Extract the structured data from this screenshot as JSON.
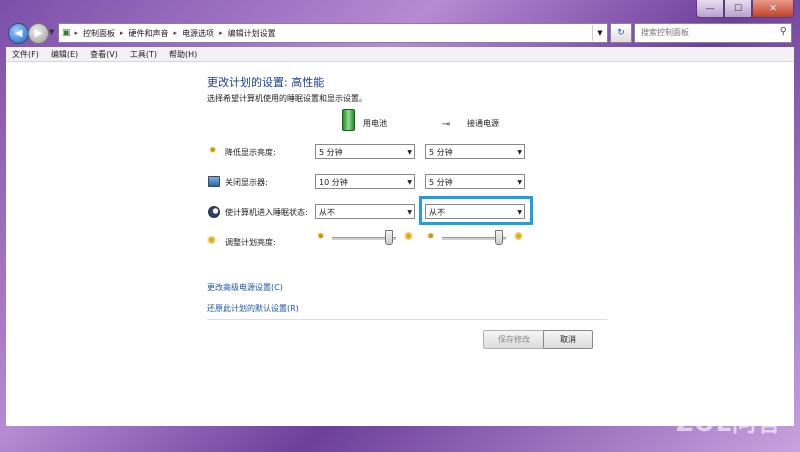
{
  "window": {
    "minimize_glyph": "—",
    "maximize_glyph": "☐",
    "close_glyph": "✕"
  },
  "nav": {
    "back_glyph": "◀",
    "forward_glyph": "▶",
    "breadcrumbs": [
      "控制面板",
      "硬件和声音",
      "电源选项",
      "编辑计划设置"
    ],
    "refresh_glyph": "↻",
    "search_placeholder": "搜索控制面板"
  },
  "menu": [
    "文件(F)",
    "编辑(E)",
    "查看(V)",
    "工具(T)",
    "帮助(H)"
  ],
  "page": {
    "title": "更改计划的设置: 高性能",
    "subtitle": "选择希望计算机使用的睡眠设置和显示设置。",
    "col_battery": "用电池",
    "col_plugged": "接通电源",
    "rows": [
      {
        "label": "降低显示亮度:",
        "battery": "5 分钟",
        "plugged": "5 分钟"
      },
      {
        "label": "关闭显示器:",
        "battery": "10 分钟",
        "plugged": "5 分钟"
      },
      {
        "label": "使计算机进入睡眠状态:",
        "battery": "从不",
        "plugged": "从不"
      }
    ],
    "brightness_label": "调整计划亮度:",
    "brightness_battery_level": 0.88,
    "brightness_plugged_level": 0.88,
    "link_advanced": "更改高级电源设置(C)",
    "link_restore": "还原此计划的默认设置(R)",
    "save_button": "保存修改",
    "cancel_button": "取消"
  },
  "watermark": "ZOL问答",
  "colors": {
    "accent_focus": "#1ea0e0",
    "title_blue": "#1a3f95",
    "link_blue": "#1a55b0"
  }
}
